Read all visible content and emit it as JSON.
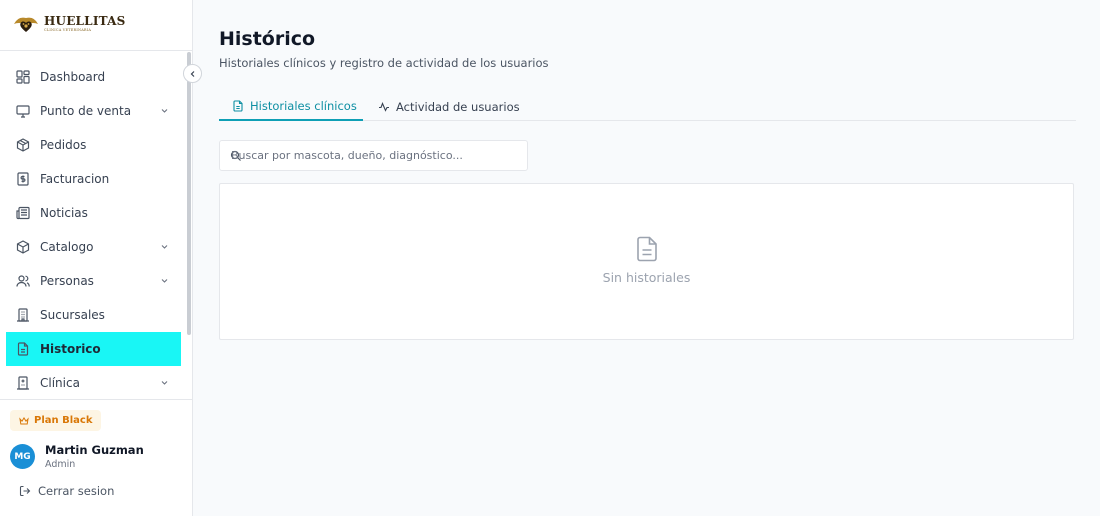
{
  "brand": {
    "name": "HUELLITAS",
    "subtitle": "CLINICA VETERINARIA",
    "accent": "#19f6f5"
  },
  "sidebar": {
    "items": [
      {
        "label": "Dashboard",
        "icon": "dashboard-icon",
        "has_submenu": false,
        "active": false
      },
      {
        "label": "Punto de venta",
        "icon": "monitor-icon",
        "has_submenu": true,
        "active": false
      },
      {
        "label": "Pedidos",
        "icon": "package-icon",
        "has_submenu": false,
        "active": false
      },
      {
        "label": "Facturacion",
        "icon": "receipt-dollar-icon",
        "has_submenu": false,
        "active": false
      },
      {
        "label": "Noticias",
        "icon": "newspaper-icon",
        "has_submenu": false,
        "active": false
      },
      {
        "label": "Catalogo",
        "icon": "box-icon",
        "has_submenu": true,
        "active": false
      },
      {
        "label": "Personas",
        "icon": "users-icon",
        "has_submenu": true,
        "active": false
      },
      {
        "label": "Sucursales",
        "icon": "building-icon",
        "has_submenu": false,
        "active": false
      },
      {
        "label": "Historico",
        "icon": "file-text-icon",
        "has_submenu": false,
        "active": true
      },
      {
        "label": "Clínica",
        "icon": "hospital-icon",
        "has_submenu": true,
        "active": false
      }
    ],
    "plan": {
      "label": "Plan Black",
      "icon": "crown-icon"
    },
    "user": {
      "initials": "MG",
      "name": "Martin Guzman",
      "role": "Admin"
    },
    "logout_label": "Cerrar sesion"
  },
  "header": {
    "title": "Histórico",
    "subtitle": "Historiales clínicos y registro de actividad de los usuarios"
  },
  "tabs": [
    {
      "label": "Historiales clínicos",
      "icon": "file-text-icon",
      "active": true
    },
    {
      "label": "Actividad de usuarios",
      "icon": "activity-icon",
      "active": false
    }
  ],
  "search": {
    "placeholder": "Buscar por mascota, dueño, diagnóstico..."
  },
  "empty_state": {
    "text": "Sin historiales",
    "icon": "file-text-icon"
  }
}
